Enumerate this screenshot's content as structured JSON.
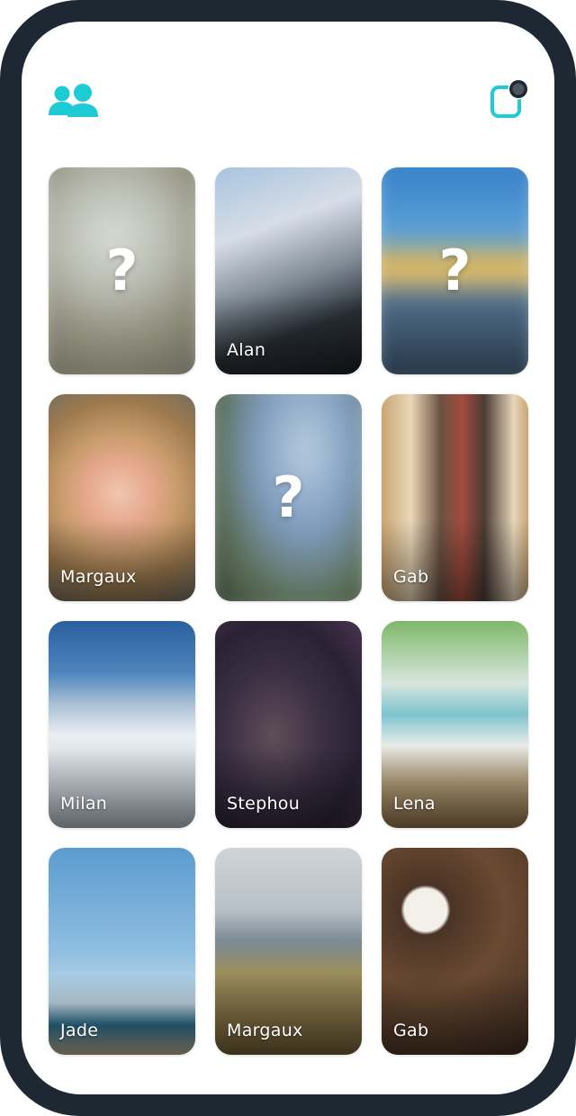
{
  "app": {
    "accent_color": "#1ecad3",
    "frame_color": "#1e2833"
  },
  "header": {
    "friends_icon": "friends-icon",
    "camera_icon": "camera-icon"
  },
  "tiles": [
    {
      "name": "",
      "hidden": true,
      "unknown_mark": "?"
    },
    {
      "name": "Alan",
      "hidden": false
    },
    {
      "name": "",
      "hidden": true,
      "unknown_mark": "?"
    },
    {
      "name": "Margaux",
      "hidden": false
    },
    {
      "name": "",
      "hidden": true,
      "unknown_mark": "?"
    },
    {
      "name": "Gab",
      "hidden": false
    },
    {
      "name": "Milan",
      "hidden": false
    },
    {
      "name": "Stephou",
      "hidden": false
    },
    {
      "name": "Lena",
      "hidden": false
    },
    {
      "name": "Jade",
      "hidden": false
    },
    {
      "name": "Margaux",
      "hidden": false
    },
    {
      "name": "Gab",
      "hidden": false
    }
  ]
}
